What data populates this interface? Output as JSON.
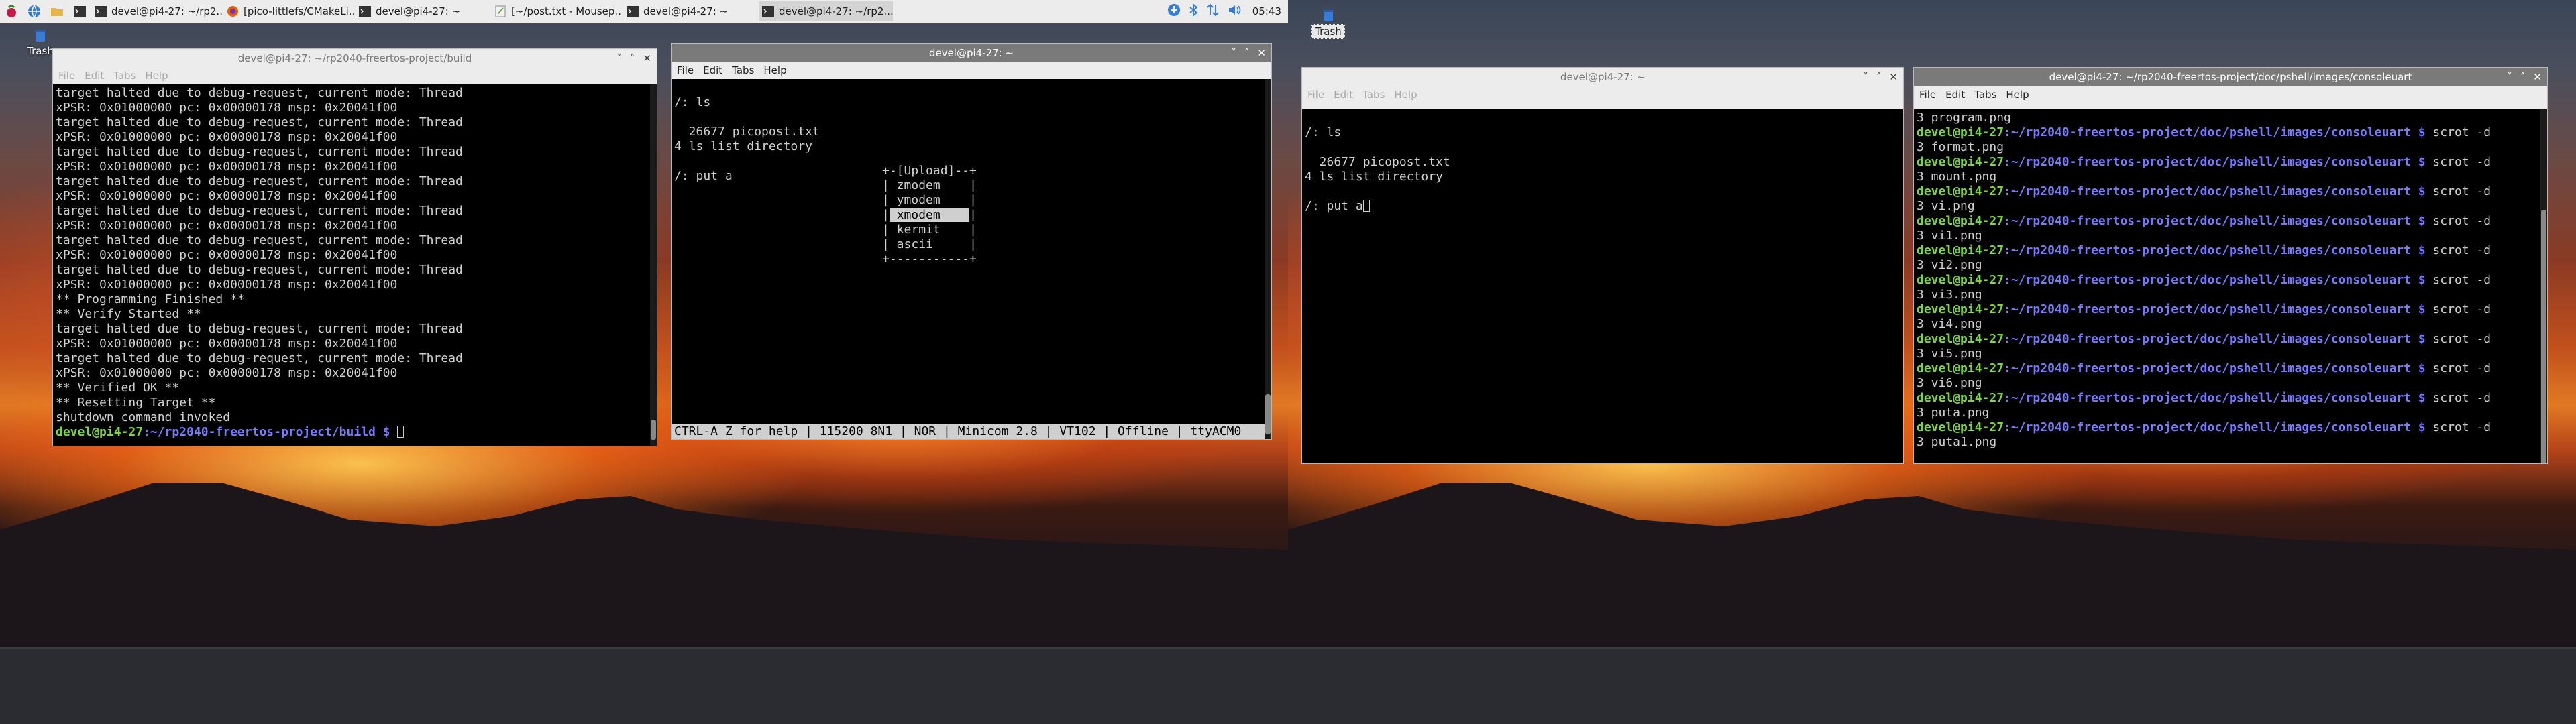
{
  "taskbar": {
    "tasks": [
      {
        "label": "devel@pi4-27: ~/rp2...",
        "icon": "terminal-icon"
      },
      {
        "label": "[pico-littlefs/CMakeLi...",
        "icon": "firefox-icon"
      },
      {
        "label": "devel@pi4-27: ~",
        "icon": "terminal-icon"
      },
      {
        "label": "[~/post.txt - Mousep...",
        "icon": "text-editor-icon"
      },
      {
        "label": "devel@pi4-27: ~",
        "icon": "terminal-icon"
      },
      {
        "label": "devel@pi4-27: ~/rp2...",
        "icon": "terminal-icon"
      }
    ],
    "clock": "05:43"
  },
  "desktop": {
    "trash_label": "Trash"
  },
  "menu": {
    "file": "File",
    "edit": "Edit",
    "tabs": "Tabs",
    "help": "Help"
  },
  "win1": {
    "title": "devel@pi4-27: ~/rp2040-freertos-project/build",
    "lines": [
      "target halted due to debug-request, current mode: Thread",
      "xPSR: 0x01000000 pc: 0x00000178 msp: 0x20041f00",
      "target halted due to debug-request, current mode: Thread",
      "xPSR: 0x01000000 pc: 0x00000178 msp: 0x20041f00",
      "target halted due to debug-request, current mode: Thread",
      "xPSR: 0x01000000 pc: 0x00000178 msp: 0x20041f00",
      "target halted due to debug-request, current mode: Thread",
      "xPSR: 0x01000000 pc: 0x00000178 msp: 0x20041f00",
      "target halted due to debug-request, current mode: Thread",
      "xPSR: 0x01000000 pc: 0x00000178 msp: 0x20041f00",
      "target halted due to debug-request, current mode: Thread",
      "xPSR: 0x01000000 pc: 0x00000178 msp: 0x20041f00",
      "target halted due to debug-request, current mode: Thread",
      "xPSR: 0x01000000 pc: 0x00000178 msp: 0x20041f00",
      "** Programming Finished **",
      "** Verify Started **",
      "target halted due to debug-request, current mode: Thread",
      "xPSR: 0x01000000 pc: 0x00000178 msp: 0x20041f00",
      "target halted due to debug-request, current mode: Thread",
      "xPSR: 0x01000000 pc: 0x00000178 msp: 0x20041f00",
      "** Verified OK **",
      "** Resetting Target **",
      "shutdown command invoked"
    ],
    "prompt_user": "devel@pi4-27",
    "prompt_path": ":~/rp2040-freertos-project/build $"
  },
  "win2": {
    "title": "devel@pi4-27: ~",
    "lines": [
      "",
      "/: ls",
      "",
      "  26677 picopost.txt",
      "4 ls list directory",
      "",
      "/: put a"
    ],
    "upload_menu": {
      "header": "+-[Upload]--+",
      "items": [
        "zmodem",
        "ymodem",
        "xmodem",
        "kermit",
        "ascii"
      ],
      "selected_index": 2,
      "footer": "+-----------+"
    },
    "status": "CTRL-A Z for help | 115200 8N1 | NOR | Minicom 2.8 | VT102 | Offline | ttyACM0"
  },
  "win3": {
    "title": "devel@pi4-27: ~",
    "lines": [
      "",
      "/: ls",
      "",
      "  26677 picopost.txt",
      "4 ls list directory",
      ""
    ],
    "last_line": "/: put a"
  },
  "win4": {
    "title": "devel@pi4-27: ~/rp2040-freertos-project/doc/pshell/images/consoleuart",
    "first_line": "3 program.png",
    "entries": [
      "3 format.png",
      "3 mount.png",
      "3 vi.png",
      "3 vi1.png",
      "3 vi2.png",
      "3 vi3.png",
      "3 vi4.png",
      "3 vi5.png",
      "3 vi6.png",
      "3 puta.png",
      "3 puta1.png"
    ],
    "prompt_user": "devel@pi4-27",
    "prompt_path": ":~/rp2040-freertos-project/doc/pshell/images/consoleuart $",
    "command": " scrot -d"
  },
  "colors": {
    "prompt_user": "#7bd83a",
    "prompt_path": "#7a7aff",
    "panel": "#ececec"
  }
}
